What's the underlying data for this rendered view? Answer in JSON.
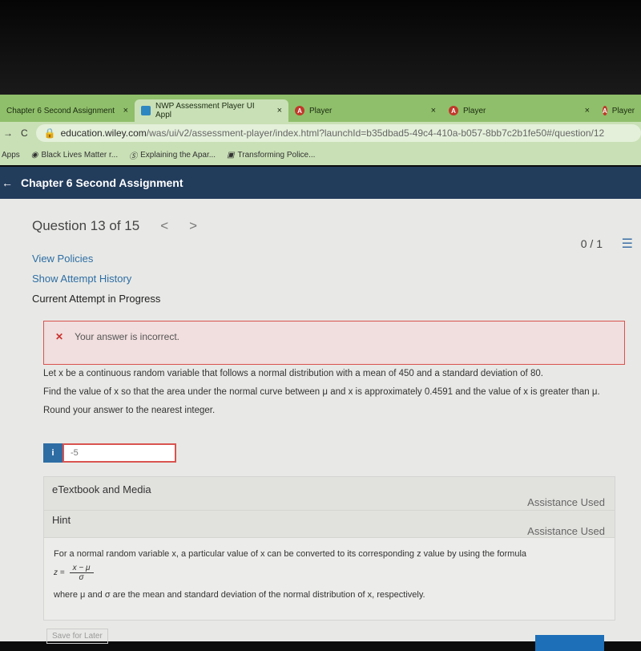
{
  "browser": {
    "tabs": [
      {
        "title": "Chapter 6 Second Assignment",
        "close": "×"
      },
      {
        "title": "NWP Assessment Player UI Appl",
        "close": "×",
        "icon": "wiley-icon"
      },
      {
        "title": "Player",
        "close": "×",
        "icon": "angular-icon"
      },
      {
        "title": "Player",
        "close": "×",
        "icon": "angular-icon"
      },
      {
        "title": "Player",
        "icon": "angular-icon"
      }
    ],
    "url_host": "education.wiley.com",
    "url_path": "/was/ui/v2/assessment-player/index.html?launchId=b35dbad5-49c4-410a-b057-8bb7c2b1fe50#/question/12",
    "bookmarks": [
      "Apps",
      "Black Lives Matter r...",
      "Explaining the Apar...",
      "Transforming Police..."
    ]
  },
  "header": {
    "back": "←",
    "title": "Chapter 6 Second Assignment"
  },
  "question_nav": {
    "label": "Question 13 of 15",
    "prev": "<",
    "next": ">",
    "score": "0 / 1",
    "list_icon": "☰"
  },
  "links": {
    "policies": "View Policies",
    "history": "Show Attempt History",
    "current": "Current Attempt in Progress"
  },
  "error": {
    "icon": "✕",
    "text": "Your answer is incorrect."
  },
  "question": {
    "p1": "Let x be a continuous random variable that follows a normal distribution with a mean of 450 and a standard deviation of 80.",
    "p2": "Find the value of x so that the area under the normal curve between μ and x is approximately 0.4591 and the value of x is greater than μ.",
    "p3": "Round your answer to the nearest integer."
  },
  "answer": {
    "info": "i",
    "value": "-5"
  },
  "etextbook": {
    "title": "eTextbook and Media",
    "status": "Assistance Used"
  },
  "hint": {
    "title": "Hint",
    "status": "Assistance Used",
    "text1": "For a normal random variable x, a particular value of x can be converted to its corresponding z value by using the formula",
    "z": "z =",
    "num": "x − μ",
    "den": "σ",
    "text2": "where μ and σ are the mean and standard deviation of the normal distribution of x, respectively."
  },
  "footer": {
    "save": "Save for Later"
  }
}
